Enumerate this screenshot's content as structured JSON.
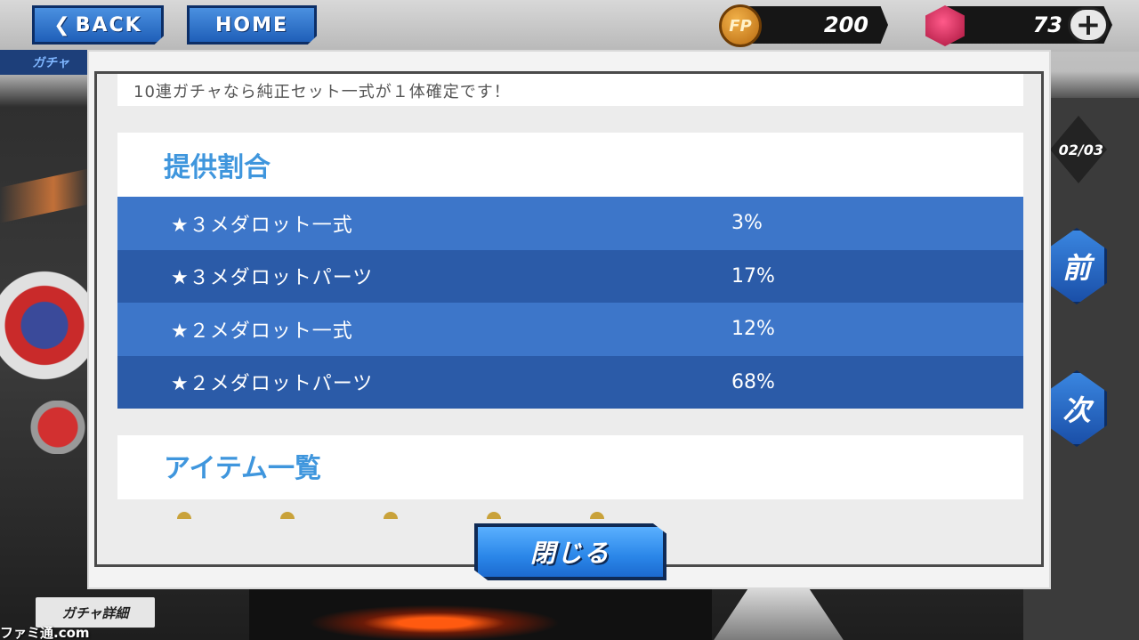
{
  "header": {
    "back_label": "BACK",
    "home_label": "HOME",
    "fp_icon_label": "FP",
    "fp_value": "200",
    "gem_value": "73",
    "plus_label": "+",
    "subtitle": "ガチャ"
  },
  "side": {
    "page_indicator": "02/03",
    "prev_label": "前",
    "next_label": "次"
  },
  "footer": {
    "detail_tab_label": "ガチャ詳細",
    "watermark": "ファミ通.com"
  },
  "modal": {
    "intro_text": "10連ガチャなら純正セット一式が１体確定です！",
    "rates_title": "提供割合",
    "rates": [
      {
        "name": "★３メダロット一式",
        "percent": "3%"
      },
      {
        "name": "★３メダロットパーツ",
        "percent": "17%"
      },
      {
        "name": "★２メダロット一式",
        "percent": "12%"
      },
      {
        "name": "★２メダロットパーツ",
        "percent": "68%"
      }
    ],
    "items_title": "アイテム一覧",
    "close_label": "閉じる"
  },
  "colors": {
    "accent_title": "#3f96dd",
    "row_light": "#3d76c9",
    "row_dark": "#2b5ba8",
    "button_blue": "#2a86e8"
  }
}
